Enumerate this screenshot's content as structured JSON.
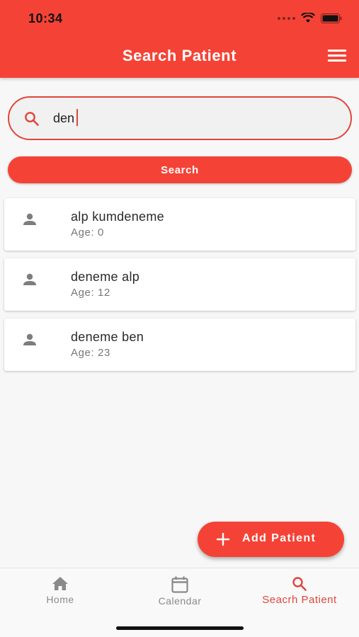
{
  "status_bar": {
    "time": "10:34"
  },
  "app_bar": {
    "title": "Search Patient"
  },
  "search": {
    "value": "den",
    "button_label": "Search"
  },
  "patients": [
    {
      "name": "alp kumdeneme",
      "age": "Age: 0"
    },
    {
      "name": "deneme alp",
      "age": "Age: 12"
    },
    {
      "name": "deneme ben",
      "age": "Age: 23"
    }
  ],
  "fab": {
    "label": "Add Patient",
    "icon": "plus-icon"
  },
  "bottom_nav": {
    "items": [
      {
        "label": "Home",
        "icon": "home-icon"
      },
      {
        "label": "Calendar",
        "icon": "calendar-icon"
      },
      {
        "label": "Seacrh Patient",
        "icon": "search-icon",
        "active": true
      }
    ]
  },
  "colors": {
    "primary": "#f44336",
    "accent_text": "#e0463c",
    "inactive": "#8a8a8a"
  }
}
